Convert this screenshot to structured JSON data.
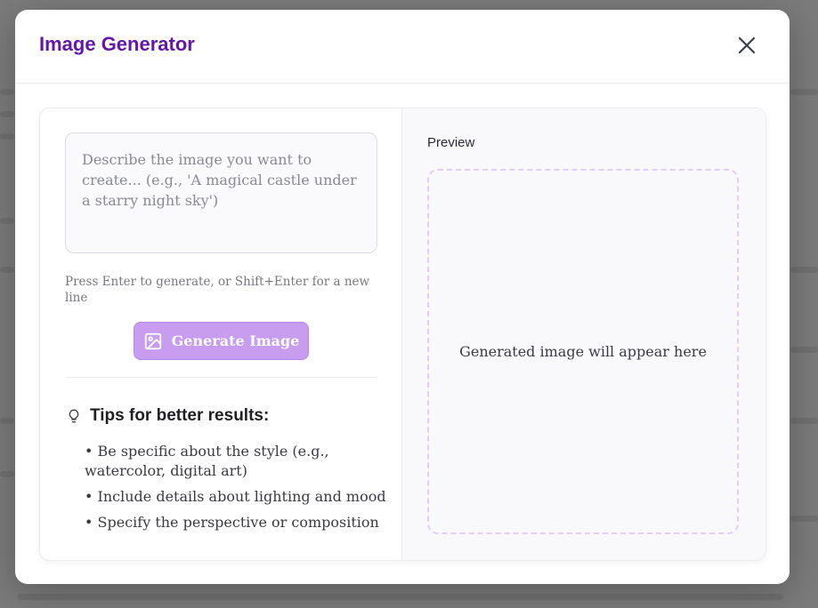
{
  "modal": {
    "title": "Image Generator",
    "close_icon": "close-icon"
  },
  "prompt": {
    "value": "",
    "placeholder": "Describe the image you want to create... (e.g., 'A magical castle under a starry night sky')",
    "hint": "Press Enter to generate, or Shift+Enter for a new line"
  },
  "generate_button": {
    "label": "Generate Image",
    "icon": "image-icon"
  },
  "tips": {
    "icon": "lightbulb-icon",
    "title": "Tips for better results:",
    "items": [
      "• Be specific about the style (e.g., watercolor, digital art)",
      "• Include details about lighting and mood",
      "• Specify the perspective or composition"
    ]
  },
  "preview": {
    "label": "Preview",
    "empty_text": "Generated image will appear here"
  },
  "colors": {
    "title": "#6418a8",
    "button": "#c89df0",
    "preview_border": "#e3cdf8",
    "backdrop": "#7b7b7b"
  }
}
